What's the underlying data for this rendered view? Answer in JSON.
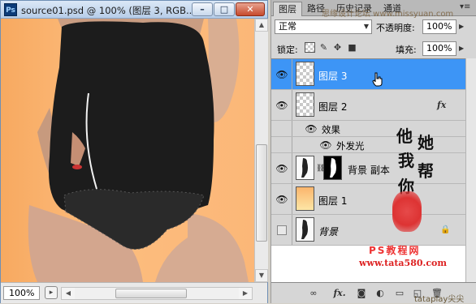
{
  "document": {
    "app_logo": "Ps",
    "title": "source01.psd @ 100% (图层 3, RGB...",
    "buttons": {
      "minimize": "–",
      "maximize": "□",
      "close": "✕"
    },
    "zoom": "100%"
  },
  "panel": {
    "tabs": [
      "图层",
      "路径",
      "历史记录",
      "通道"
    ],
    "blend_mode": "正常",
    "opacity_label": "不透明度:",
    "opacity": "100%",
    "lock_label": "锁定:",
    "fill_label": "填充:",
    "fill": "100%",
    "layers": [
      {
        "name": "图层 3",
        "selected": true,
        "visible": true
      },
      {
        "name": "图层 2",
        "selected": false,
        "visible": true,
        "fx": "fx"
      },
      {
        "name": "背景 副本",
        "selected": false,
        "visible": true
      },
      {
        "name": "图层 1",
        "selected": false,
        "visible": true
      },
      {
        "name": "背景",
        "selected": false,
        "visible": false
      }
    ],
    "effects_label": "效果",
    "effect_outer_glow": "外发光"
  },
  "overlay": {
    "calligraphy": [
      "他",
      "她",
      "我",
      "帮",
      "你"
    ],
    "watermark_ps": "PS教程网",
    "watermark_url": "www.tata580.com",
    "watermark_top": "思缘设计论坛 www.missyuan.com",
    "watermark_bottom": "tataplay尖尖"
  },
  "colors": {
    "selection": "#3d95f6",
    "canvas_background": "#fbb778",
    "seal": "#d33333"
  }
}
